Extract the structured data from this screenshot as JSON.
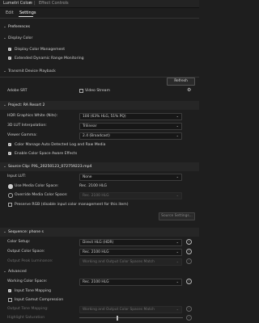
{
  "panel_tabs": [
    "Lumetri Color",
    "Effect Controls"
  ],
  "menu_glyph": "≡",
  "sub_tabs": [
    "Edit",
    "Settings"
  ],
  "preferences": {
    "title": "Preferences",
    "display_color": {
      "title": "Display Color",
      "items": [
        "Display Color Management",
        "Extended Dynamic Range Monitoring"
      ]
    },
    "transmit": {
      "title": "Transmit Device Playback",
      "refresh_label": "Refresh",
      "adobe_srt": "Adobe SRT",
      "video_stream": "Video Stream"
    }
  },
  "project": {
    "title": "Project: RA Resort 2",
    "hdr_label": "HDR Graphics White (Nits):",
    "hdr_value": "100 (63% HLG, 51% PQ)",
    "lut_interp_label": "3D LUT Interpolation:",
    "lut_interp_value": "Trilinear",
    "gamma_label": "Viewer Gamma:",
    "gamma_value": "2.4 (Broadcast)",
    "check1": "Color Manage Auto Detected Log and Raw Media",
    "check2": "Enable Color Space Aware Effects"
  },
  "source": {
    "title": "Source Clip: PXL_20250123_072759223.mp4",
    "input_lut_label": "Input LUT:",
    "input_lut_value": "None",
    "use_media_label": "Use Media Color Space:",
    "use_media_value": "Rec. 2100 HLG",
    "override_label": "Override Media Color Space:",
    "override_value": "Rec. 2100 HLG",
    "preserve_label": "Preserve RGB (disable input color management for this item)",
    "source_settings": "Source Settings..."
  },
  "sequence": {
    "title": "Sequence: phone s",
    "color_setup_label": "Color Setup:",
    "color_setup_value": "Direct HLG (HDR)",
    "output_cs_label": "Output Color Space:",
    "output_cs_value": "Rec. 2100 HLG",
    "peak_label": "Output Peak Luminance:",
    "peak_value": "Working and Output Color Spaces Match"
  },
  "advanced": {
    "title": "Advanced",
    "working_label": "Working Color Space:",
    "working_value": "Rec. 2100 HLG",
    "input_tone": "Input Tone Mapping",
    "input_gamut": "Input Gamut Compression",
    "output_tone_label": "Output Tone Mapping:",
    "output_tone_value": "Working and Output Color Spaces Match",
    "highlight_label": "Highlight Saturation"
  }
}
